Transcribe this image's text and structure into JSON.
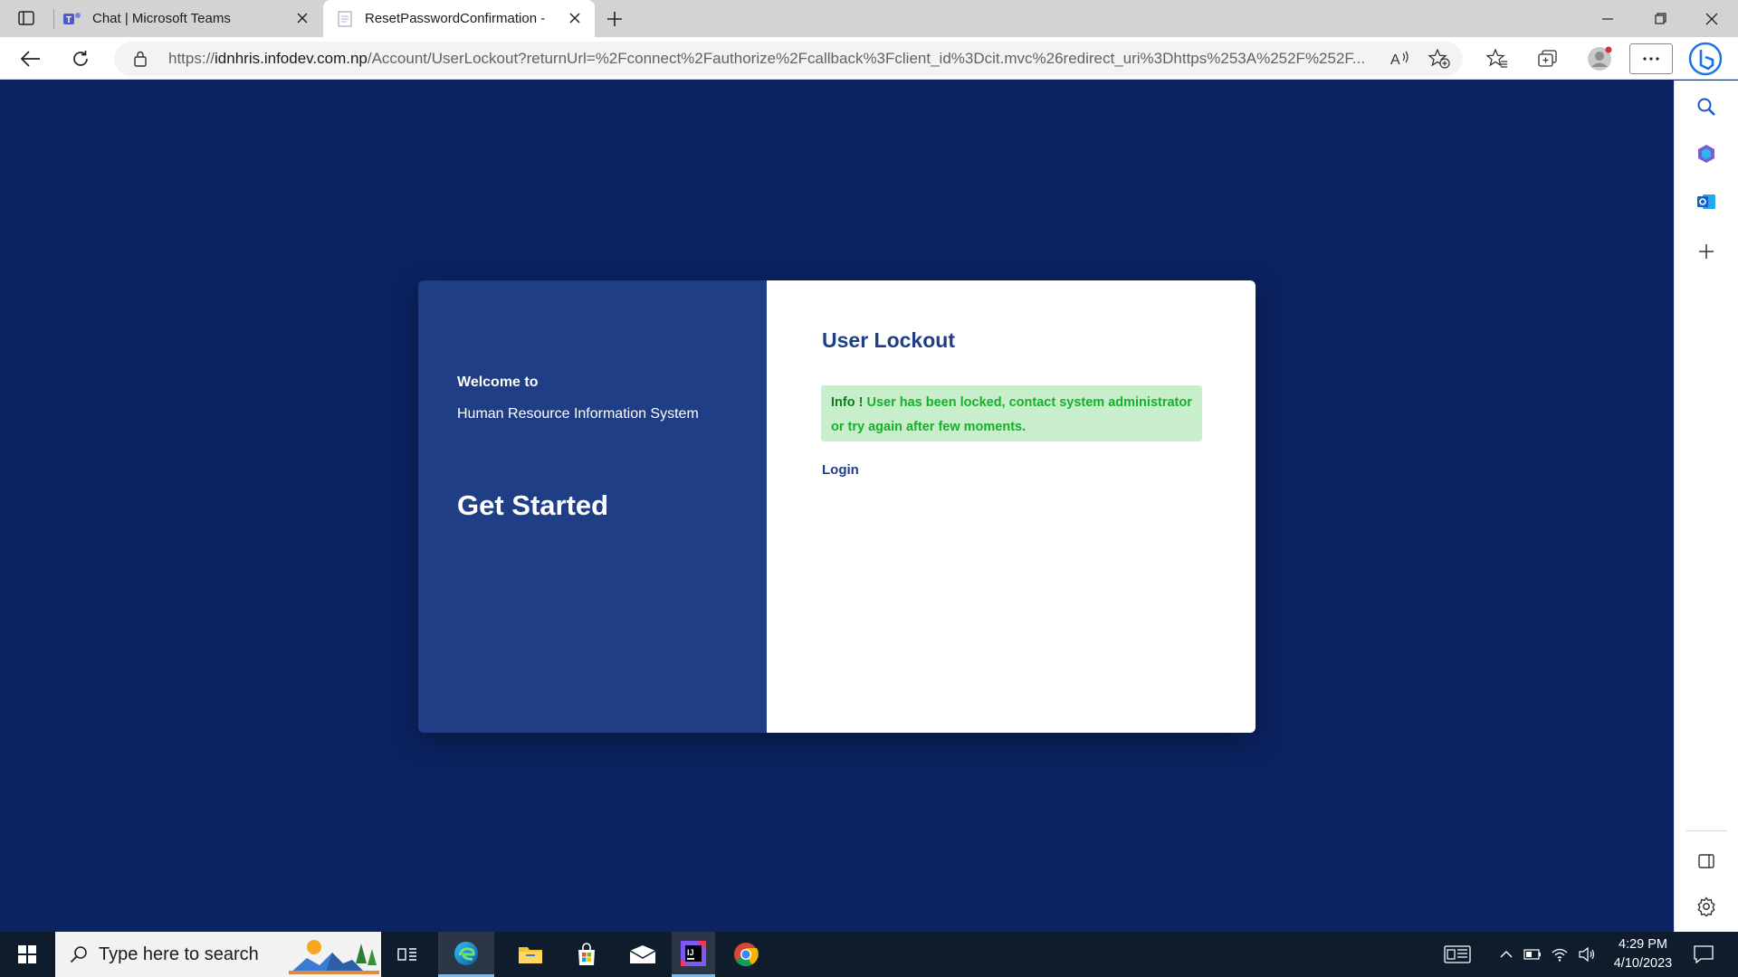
{
  "browser": {
    "tabs": [
      {
        "title": "Chat | Microsoft Teams",
        "icon": "teams-icon",
        "active": false
      },
      {
        "title": "ResetPasswordConfirmation -",
        "icon": "page-icon",
        "active": true
      }
    ],
    "address": {
      "host_prefix": "https://",
      "host": "idnhris.infodev.com.np",
      "path": "/Account/UserLockout?returnUrl=%2Fconnect%2Fauthorize%2Fcallback%3Fclient_id%3Dcit.mvc%26redirect_uri%3Dhttps%253A%252F%252F..."
    }
  },
  "page": {
    "background_color": "#0b2360",
    "left_panel": {
      "welcome": "Welcome to",
      "system_name": "Human Resource Information System",
      "cta": "Get Started"
    },
    "right_panel": {
      "title": "User Lockout",
      "alert_label": "Info !",
      "alert_message": " User has been locked, contact system administrator or try again after few moments.",
      "login_link": "Login"
    },
    "colors": {
      "accent": "#1f3e86",
      "alert_bg": "#c8eecb",
      "alert_text": "#16b02c"
    }
  },
  "taskbar": {
    "search_placeholder": "Type here to search",
    "apps": [
      "task-view-icon",
      "edge-icon",
      "file-explorer-icon",
      "store-icon",
      "mail-icon",
      "intellij-icon",
      "chrome-icon"
    ],
    "clock": {
      "time": "4:29 PM",
      "date": "4/10/2023"
    }
  }
}
